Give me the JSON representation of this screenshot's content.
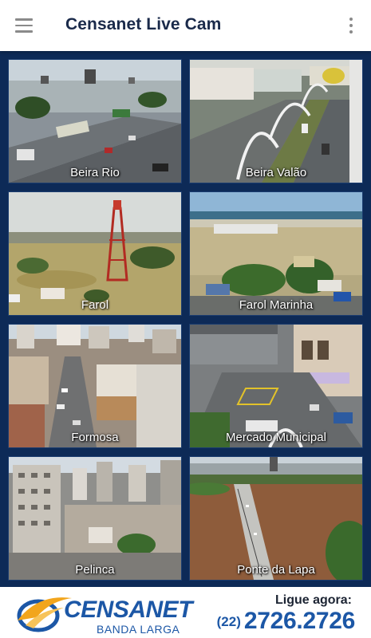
{
  "app_bar": {
    "title": "Censanet Live Cam",
    "menu_icon": "hamburger-menu-icon",
    "overflow_icon": "more-vert-icon"
  },
  "cameras": [
    {
      "label": "Beira Rio"
    },
    {
      "label": "Beira Valão"
    },
    {
      "label": "Farol"
    },
    {
      "label": "Farol Marinha"
    },
    {
      "label": "Formosa"
    },
    {
      "label": "Mercado Municipal"
    },
    {
      "label": "Pelinca"
    },
    {
      "label": "Ponte da Lapa"
    }
  ],
  "footer": {
    "brand": "CENSANET",
    "brand_sub": "BANDA LARGA",
    "cta": "Ligue agora:",
    "phone_area": "(22)",
    "phone_number": "2726.2726"
  },
  "colors": {
    "grid_background": "#0d2a57",
    "brand_blue": "#1c57a6",
    "brand_orange": "#f2a51c",
    "title_text": "#1a2a4a"
  }
}
